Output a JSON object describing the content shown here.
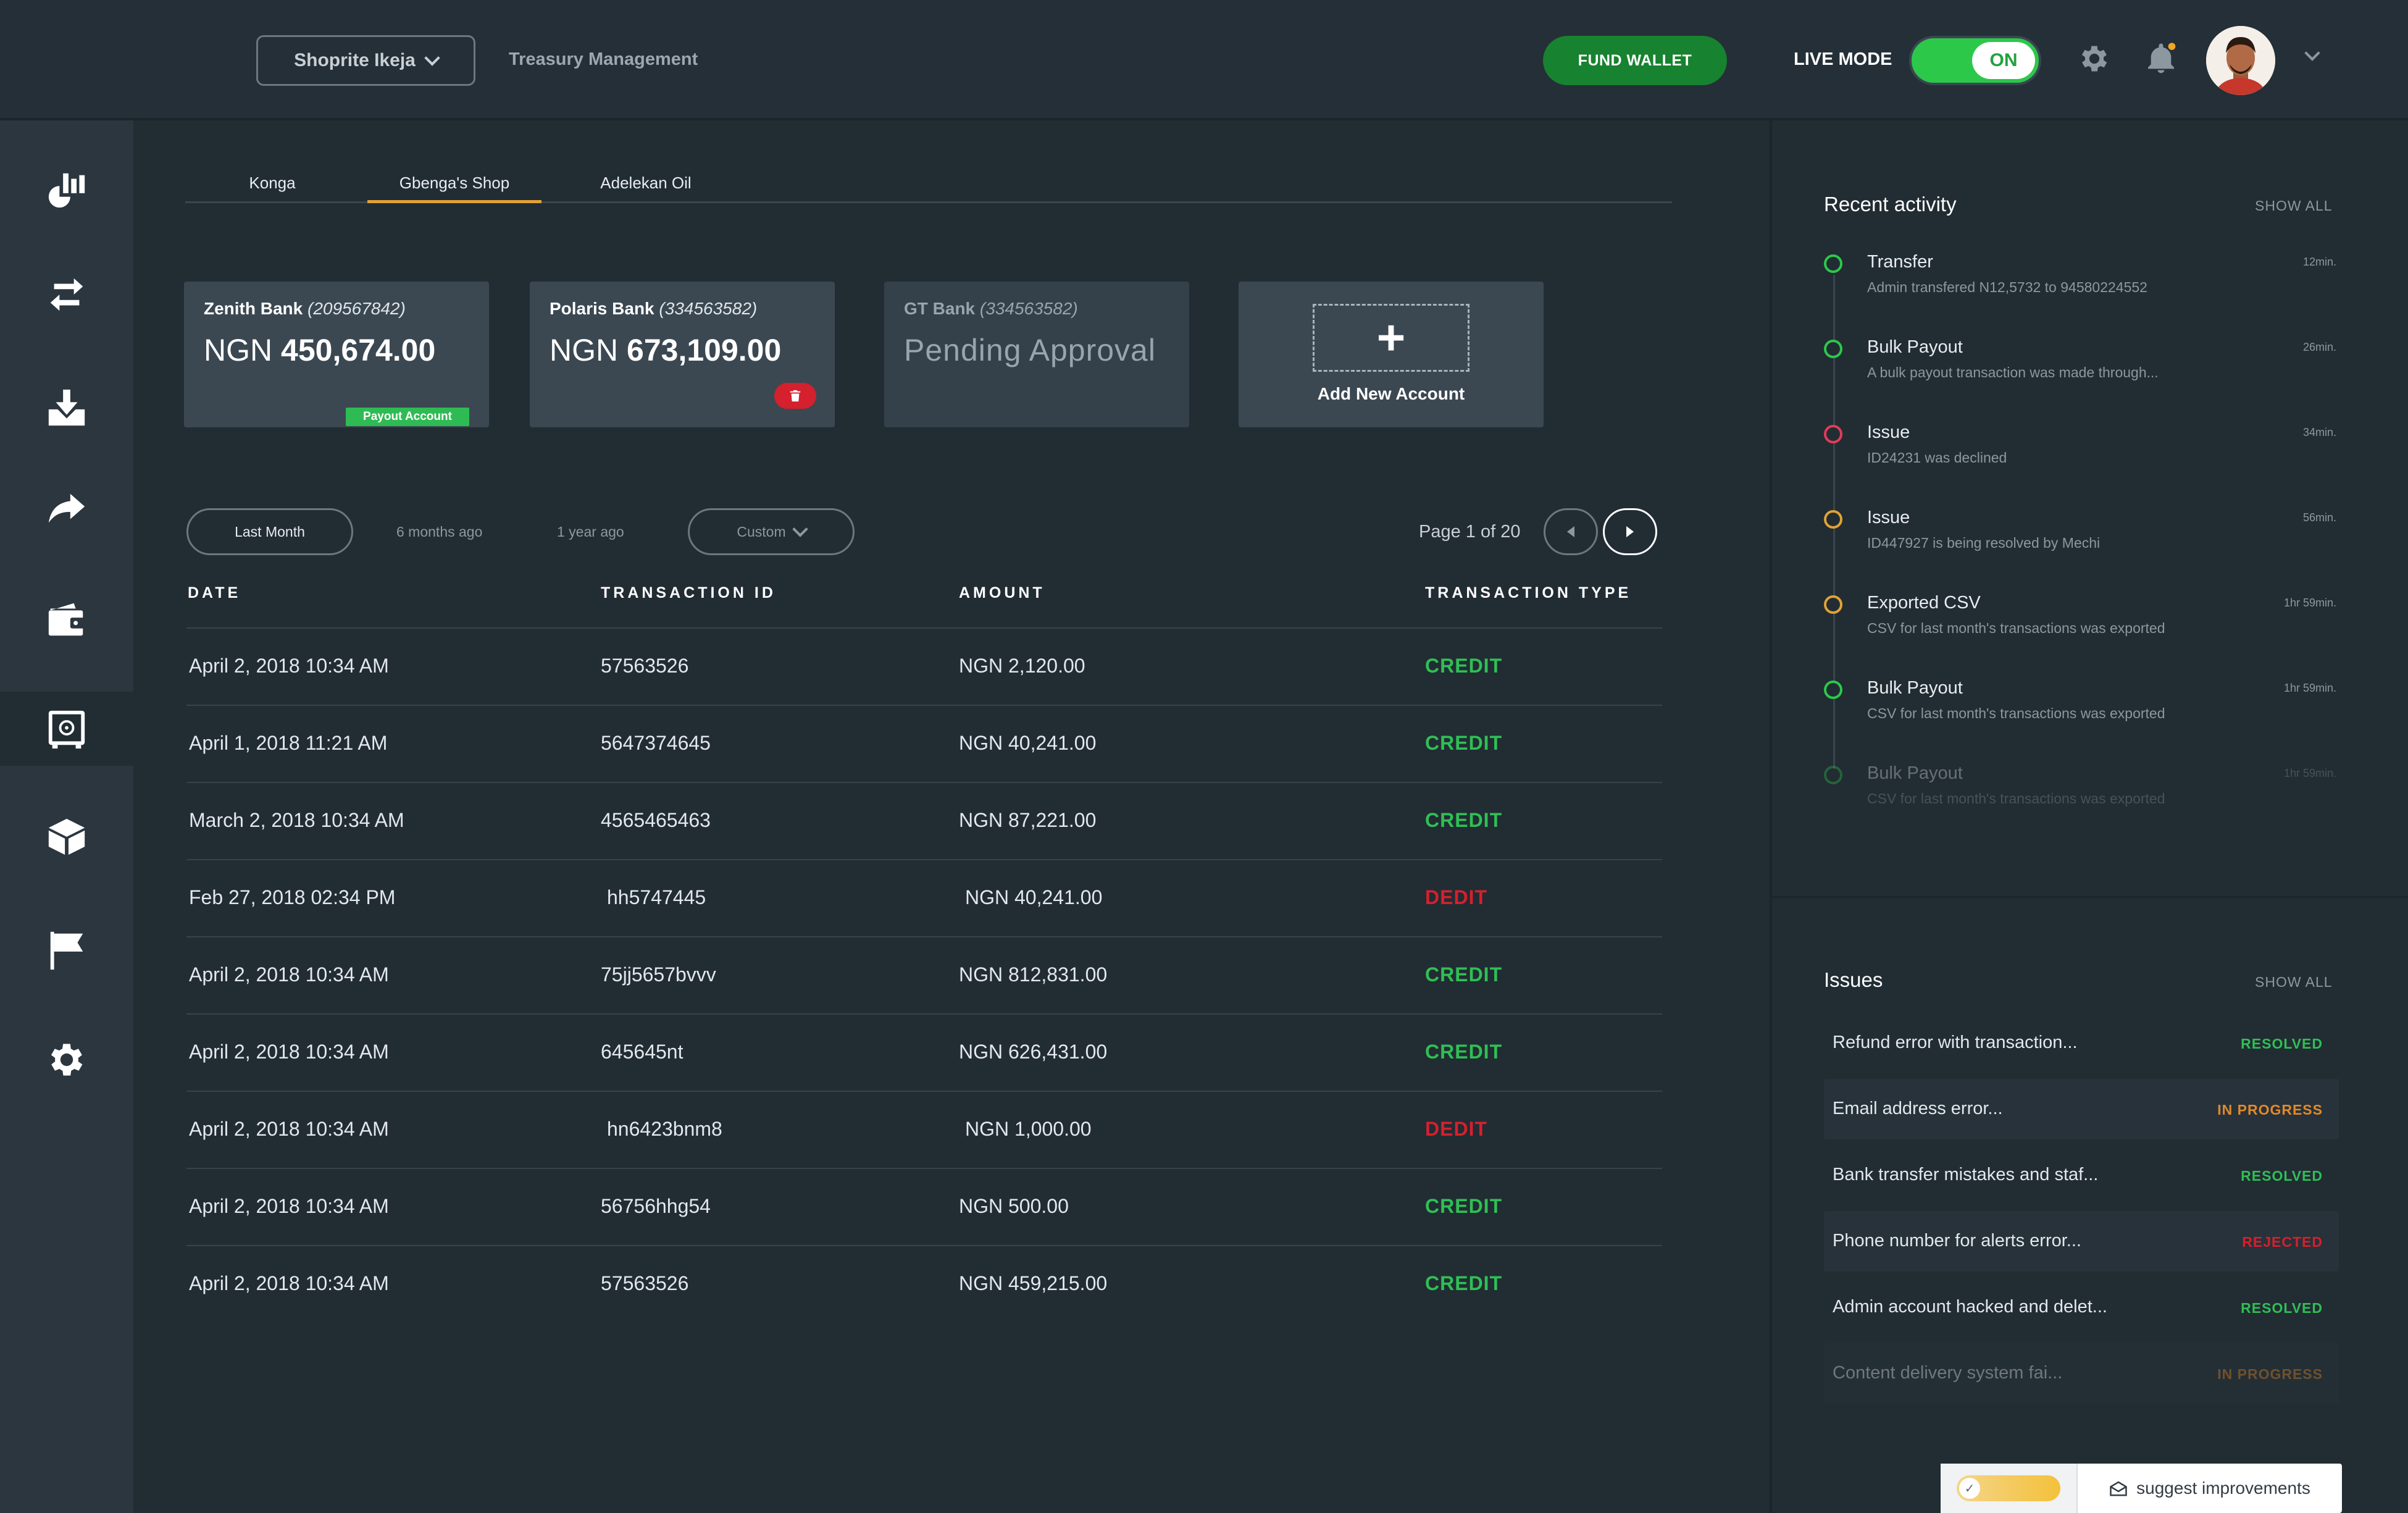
{
  "topbar": {
    "branch": "Shoprite Ikeja",
    "title": "Treasury Management",
    "fund_wallet": "FUND WALLET",
    "live_mode_label": "LIVE MODE",
    "toggle_state": "ON"
  },
  "tabs": [
    {
      "label": "Konga"
    },
    {
      "label": "Gbenga's Shop"
    },
    {
      "label": "Adelekan Oil"
    }
  ],
  "accounts": [
    {
      "bank": "Zenith Bank",
      "number": "(209567842)",
      "currency": "NGN",
      "balance": "450,674.00",
      "badge": "Payout Account"
    },
    {
      "bank": "Polaris Bank",
      "number": "(334563582)",
      "currency": "NGN",
      "balance": "673,109.00"
    },
    {
      "bank": "GT Bank",
      "number": "(334563582)",
      "status": "Pending Approval"
    }
  ],
  "add_account": {
    "plus": "+",
    "label": "Add New Account"
  },
  "filters": {
    "last_month": "Last Month",
    "six_months": "6 months ago",
    "one_year": "1 year ago",
    "custom": "Custom"
  },
  "pagination": {
    "label": "Page 1 of 20"
  },
  "table": {
    "headers": [
      "DATE",
      "TRANSACTION ID",
      "AMOUNT",
      "TRANSACTION TYPE"
    ],
    "rows": [
      {
        "date": "April 2, 2018 10:34 AM",
        "id": "57563526",
        "amount": "NGN 2,120.00",
        "type": "CREDIT"
      },
      {
        "date": "April 1, 2018 11:21 AM",
        "id": "5647374645",
        "amount": "NGN 40,241.00",
        "type": "CREDIT"
      },
      {
        "date": "March 2, 2018 10:34 AM",
        "id": "4565465463",
        "amount": "NGN 87,221.00",
        "type": "CREDIT"
      },
      {
        "date": "Feb 27, 2018 02:34 PM",
        "id": "hh5747445",
        "amount": "NGN 40,241.00",
        "type": "DEDIT"
      },
      {
        "date": "April 2, 2018 10:34 AM",
        "id": "75jj5657bvvv",
        "amount": "NGN 812,831.00",
        "type": "CREDIT"
      },
      {
        "date": "April 2, 2018 10:34 AM",
        "id": "645645nt",
        "amount": "NGN 626,431.00",
        "type": "CREDIT"
      },
      {
        "date": "April 2, 2018 10:34 AM",
        "id": "hn6423bnm8",
        "amount": "NGN 1,000.00",
        "type": "DEDIT"
      },
      {
        "date": "April 2, 2018 10:34 AM",
        "id": "56756hhg54",
        "amount": "NGN 500.00",
        "type": "CREDIT"
      },
      {
        "date": "April 2, 2018 10:34 AM",
        "id": "57563526",
        "amount": "NGN 459,215.00",
        "type": "CREDIT"
      }
    ]
  },
  "colors": {
    "credit": "#2fbf55",
    "debit": "#d5202d",
    "accent_tab": "#e0a336",
    "resolved": "#2fbf55",
    "in_progress": "#e0892a",
    "rejected": "#d5202d"
  },
  "recent_activity": {
    "title": "Recent activity",
    "show_all": "SHOW ALL",
    "items": [
      {
        "title": "Transfer",
        "desc": "Admin transfered N12,5732 to 94580224552",
        "time": "12min.",
        "color": "#2cc84a"
      },
      {
        "title": "Bulk Payout",
        "desc": "A bulk payout transaction was made through...",
        "time": "26min.",
        "color": "#2cc84a"
      },
      {
        "title": "Issue",
        "desc": "ID24231 was declined",
        "time": "34min.",
        "color": "#e23b5a"
      },
      {
        "title": "Issue",
        "desc": "ID447927 is being resolved by Mechi",
        "time": "56min.",
        "color": "#e0a336"
      },
      {
        "title": "Exported CSV",
        "desc": "CSV for last month's transactions was exported",
        "time": "1hr 59min.",
        "color": "#e0a336"
      },
      {
        "title": "Bulk Payout",
        "desc": "CSV for last month's transactions was exported",
        "time": "1hr 59min.",
        "color": "#2cc84a"
      },
      {
        "title": "Bulk Payout",
        "desc": "CSV for last month's transactions was exported",
        "time": "1hr 59min.",
        "color": "#2cc84a"
      }
    ]
  },
  "issues": {
    "title": "Issues",
    "show_all": "SHOW ALL",
    "items": [
      {
        "text": "Refund error with transaction...",
        "status": "RESOLVED"
      },
      {
        "text": "Email address error...",
        "status": "IN PROGRESS"
      },
      {
        "text": "Bank transfer mistakes and staf...",
        "status": "RESOLVED"
      },
      {
        "text": "Phone number for alerts error...",
        "status": "REJECTED"
      },
      {
        "text": "Admin account hacked and delet...",
        "status": "RESOLVED"
      },
      {
        "text": "Content delivery system fai...",
        "status": "IN PROGRESS"
      }
    ]
  },
  "suggest": {
    "label": "suggest improvements"
  }
}
